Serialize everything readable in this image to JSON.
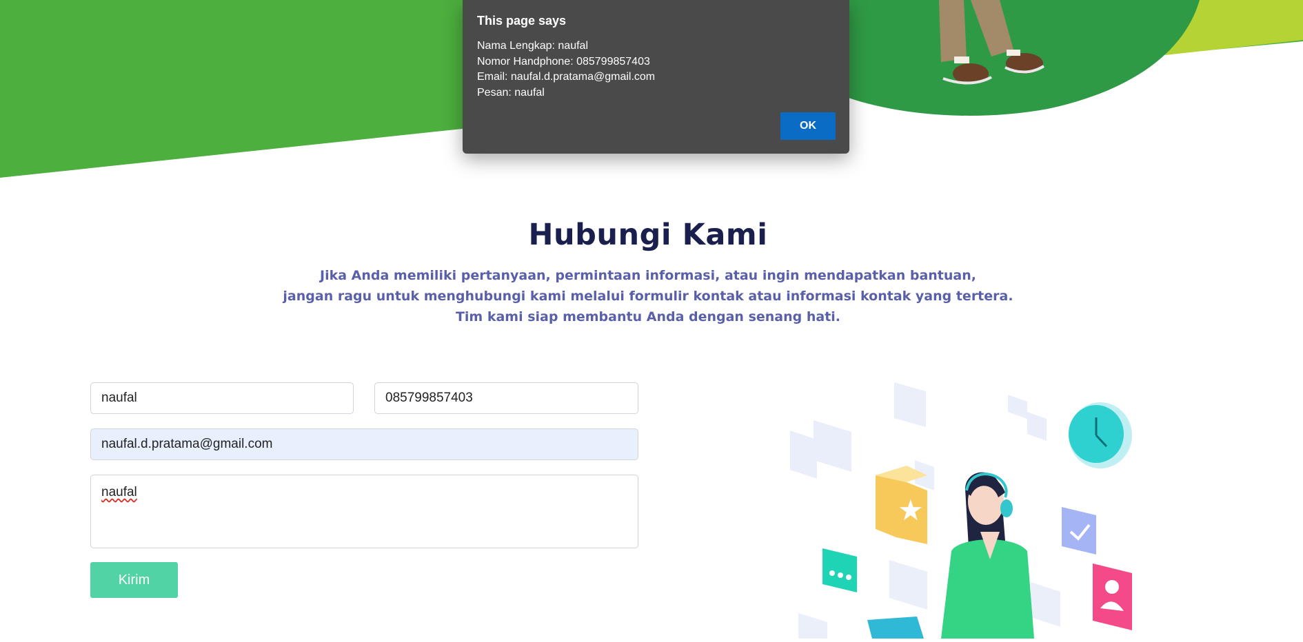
{
  "dialog": {
    "title": "This page says",
    "lines": [
      "Nama Lengkap: naufal",
      "Nomor Handphone: 085799857403",
      "Email: naufal.d.pratama@gmail.com",
      "Pesan: naufal"
    ],
    "ok_label": "OK"
  },
  "contact": {
    "title": "Hubungi Kami",
    "description_lines": [
      "Jika Anda memiliki pertanyaan, permintaan informasi, atau ingin mendapatkan bantuan,",
      "jangan ragu untuk menghubungi kami melalui formulir kontak atau informasi kontak yang tertera.",
      "Tim kami siap membantu Anda dengan senang hati."
    ]
  },
  "form": {
    "name_value": "naufal",
    "phone_value": "085799857403",
    "email_value": "naufal.d.pratama@gmail.com",
    "message_value": "naufal",
    "submit_label": "Kirim"
  },
  "colors": {
    "hero_green": "#4caf3e",
    "hero_dark_green": "#2f9a45",
    "hero_lime": "#b5d334",
    "title": "#1a1f4d",
    "description": "#5a60a8",
    "submit": "#52d3a6",
    "dialog_bg": "#4a4a4a",
    "dialog_ok": "#0a6cc4"
  }
}
